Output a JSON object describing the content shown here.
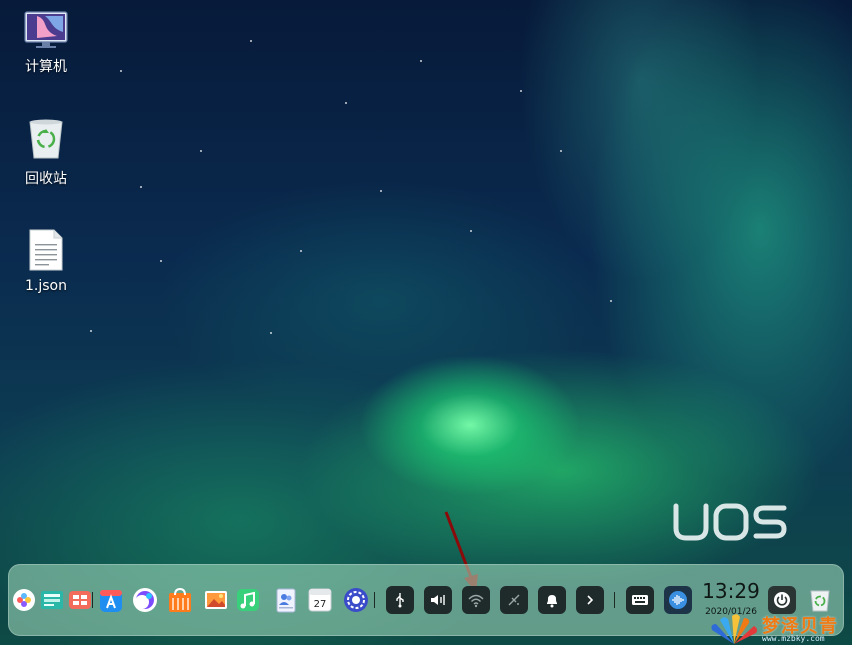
{
  "desktop": {
    "icons": [
      {
        "label": "计算机",
        "icon": "computer-icon"
      },
      {
        "label": "回收站",
        "icon": "trash-icon"
      },
      {
        "label": "1.json",
        "icon": "document-icon"
      }
    ],
    "logo_text": "UOS"
  },
  "dock": {
    "apps": [
      {
        "name": "launcher",
        "icon": "launcher-icon"
      },
      {
        "name": "multitasking",
        "icon": "multitasking-view-icon"
      },
      {
        "name": "file-manager",
        "icon": "file-manager-icon"
      },
      {
        "name": "app-store",
        "icon": "app-store-icon"
      },
      {
        "name": "browser",
        "icon": "browser-icon"
      },
      {
        "name": "store",
        "icon": "store-bag-icon"
      },
      {
        "name": "image-viewer",
        "icon": "image-viewer-icon"
      },
      {
        "name": "music",
        "icon": "music-icon"
      },
      {
        "name": "contacts",
        "icon": "contacts-icon"
      },
      {
        "name": "calendar",
        "icon": "calendar-icon",
        "badge": "27"
      },
      {
        "name": "control-center",
        "icon": "settings-gear-icon"
      }
    ],
    "tray": [
      {
        "name": "usb",
        "icon": "usb-icon"
      },
      {
        "name": "volume",
        "icon": "volume-icon"
      },
      {
        "name": "network",
        "icon": "wireless-icon"
      },
      {
        "name": "bluetooth",
        "icon": "bluetooth-off-icon"
      },
      {
        "name": "notifications",
        "icon": "bell-icon"
      },
      {
        "name": "expand",
        "icon": "chevron-right-icon"
      },
      {
        "name": "keyboard",
        "icon": "keyboard-icon"
      },
      {
        "name": "assistant",
        "icon": "voice-assistant-icon"
      }
    ],
    "clock": {
      "time": "13:29",
      "date": "2020/01/26"
    },
    "power_icon": "power-icon",
    "trash_icon": "trash-icon"
  },
  "watermark": {
    "brand": "梦泽贝青",
    "url": "www.mzbky.com"
  },
  "colors": {
    "aurora_green": "#2ee08a",
    "dock_bg": "#a9dfc3",
    "tray_bg": "#1f2a2a",
    "arrow": "#8b0a0a",
    "watermark_orange": "#f07a14"
  }
}
